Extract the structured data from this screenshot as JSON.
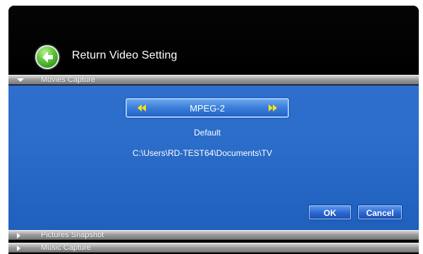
{
  "header": {
    "title": "Return Video Setting",
    "back_icon": "back-arrow-icon"
  },
  "sections": [
    {
      "label": "Movies Capture",
      "expanded": true
    },
    {
      "label": "Pictures Snapshot",
      "expanded": false
    },
    {
      "label": "Music Capture",
      "expanded": false
    }
  ],
  "movies": {
    "format": "MPEG-2",
    "quality": "Default",
    "path": "C:\\Users\\RD-TEST64\\Documents\\TV"
  },
  "buttons": {
    "ok": "OK",
    "cancel": "Cancel"
  },
  "colors": {
    "panel": "#2b6dc9",
    "header": "#000000",
    "accent_arrow": "#f7e21a",
    "back_green": "#5cc33a"
  }
}
